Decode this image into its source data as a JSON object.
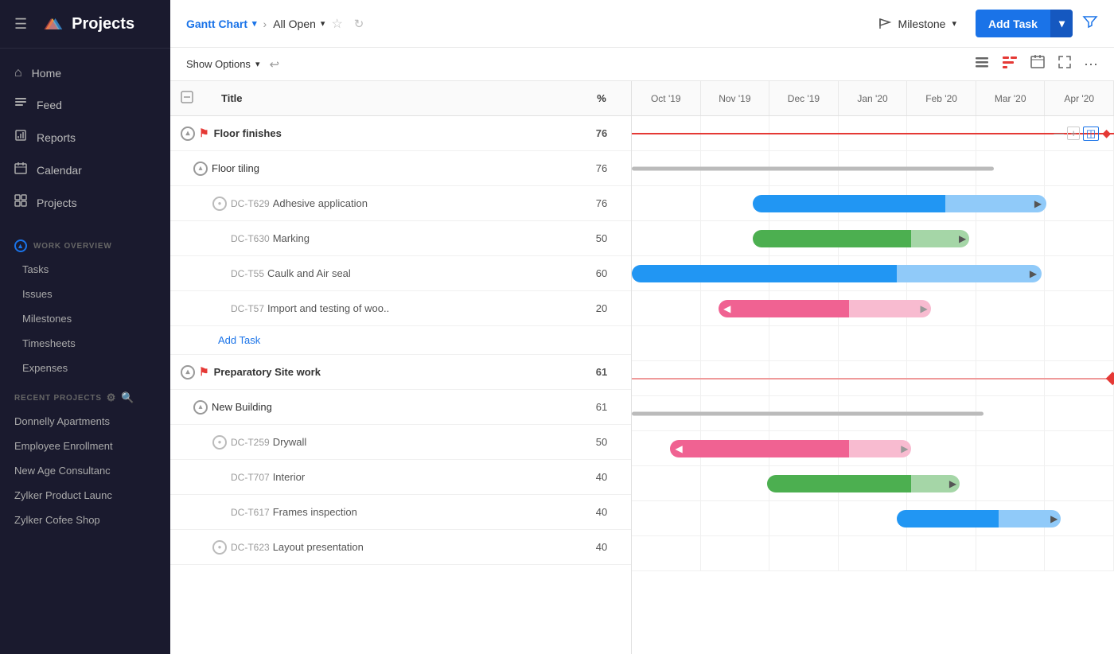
{
  "app": {
    "name": "Projects",
    "logo_colors": [
      "#f4c542",
      "#42a5f5",
      "#ef5350"
    ]
  },
  "header": {
    "hamburger": "☰",
    "view_label": "Gantt Chart",
    "filter_label": "All Open",
    "milestone_label": "Milestone",
    "add_task_label": "Add Task"
  },
  "toolbar": {
    "show_options": "Show Options"
  },
  "sidebar": {
    "nav": [
      {
        "id": "home",
        "label": "Home",
        "icon": "⌂"
      },
      {
        "id": "feed",
        "label": "Feed",
        "icon": "≡"
      },
      {
        "id": "reports",
        "label": "Reports",
        "icon": "□"
      },
      {
        "id": "calendar",
        "label": "Calendar",
        "icon": "📅"
      },
      {
        "id": "projects",
        "label": "Projects",
        "icon": "◫"
      }
    ],
    "work_overview": {
      "title": "WORK OVERVIEW",
      "items": [
        "Tasks",
        "Issues",
        "Milestones",
        "Timesheets",
        "Expenses"
      ]
    },
    "recent_projects": {
      "title": "RECENT PROJECTS",
      "items": [
        "Donnelly Apartments",
        "Employee Enrollment",
        "New Age Consultanc",
        "Zylker Product Launc",
        "Zylker Cofee Shop"
      ]
    }
  },
  "gantt": {
    "columns": {
      "title": "Title",
      "percent": "%"
    },
    "months": [
      "Oct '19",
      "Nov '19",
      "Dec '19",
      "Jan '20",
      "Feb '20",
      "Mar '20",
      "Apr '20"
    ],
    "rows": [
      {
        "id": "floor-finishes",
        "level": 0,
        "type": "group",
        "label": "Floor finishes",
        "percent": 76,
        "has_expand": true,
        "bar_type": "red_line",
        "bar_start": 0,
        "bar_end": 95
      },
      {
        "id": "floor-tiling",
        "level": 1,
        "type": "sub",
        "label": "Floor tiling",
        "percent": 76,
        "has_expand": true,
        "bar_type": "gray_line",
        "bar_start": 0,
        "bar_end": 75
      },
      {
        "id": "dc-t629",
        "level": 2,
        "type": "task",
        "task_id": "DC-T629",
        "label": "Adhesive application",
        "percent": 76,
        "bar_type": "blue_plus_light",
        "bar_start": 25,
        "bar_end": 65,
        "bar_light_end": 85
      },
      {
        "id": "dc-t630",
        "level": 2,
        "type": "task",
        "task_id": "DC-T630",
        "label": "Marking",
        "percent": 50,
        "bar_type": "green_plus_light",
        "bar_start": 25,
        "bar_end": 58,
        "bar_light_end": 68
      },
      {
        "id": "dc-t55",
        "level": 2,
        "type": "task",
        "task_id": "DC-T55",
        "label": "Caulk and Air seal",
        "percent": 60,
        "bar_type": "blue_plus_light",
        "bar_start": 0,
        "bar_end": 55,
        "bar_light_end": 85
      },
      {
        "id": "dc-t57",
        "level": 2,
        "type": "task",
        "task_id": "DC-T57",
        "label": "Import and testing of woo..",
        "percent": 20,
        "bar_type": "red_plus_light",
        "bar_start": 18,
        "bar_end": 45,
        "bar_light_end": 62
      },
      {
        "id": "add-task",
        "type": "add",
        "label": "Add Task"
      },
      {
        "id": "prep-site",
        "level": 0,
        "type": "group",
        "label": "Preparatory Site work",
        "percent": 61,
        "has_expand": true,
        "bar_type": "red_line_diamond",
        "bar_start": 0,
        "bar_end": 100
      },
      {
        "id": "new-building",
        "level": 1,
        "type": "sub",
        "label": "New Building",
        "percent": 61,
        "has_expand": true,
        "bar_type": "gray_line",
        "bar_start": 0,
        "bar_end": 73
      },
      {
        "id": "dc-t259",
        "level": 2,
        "type": "task",
        "task_id": "DC-T259",
        "label": "Drywall",
        "percent": 50,
        "bar_type": "red_plus_light",
        "bar_start": 8,
        "bar_end": 45,
        "bar_light_end": 58
      },
      {
        "id": "dc-t707",
        "level": 2,
        "type": "task",
        "task_id": "DC-T707",
        "label": "Interior",
        "percent": 40,
        "bar_type": "green_plus_light",
        "bar_start": 28,
        "bar_end": 58,
        "bar_light_end": 68
      },
      {
        "id": "dc-t617",
        "level": 2,
        "type": "task",
        "task_id": "DC-T617",
        "label": "Frames inspection",
        "percent": 40,
        "bar_type": "blue_plus_light",
        "bar_start": 55,
        "bar_end": 76,
        "bar_light_end": 89
      },
      {
        "id": "dc-t623",
        "level": 2,
        "type": "task",
        "task_id": "DC-T623",
        "label": "Layout presentation",
        "percent": 40,
        "has_expand": true,
        "bar_type": "none",
        "bar_start": 0,
        "bar_end": 0
      }
    ]
  }
}
